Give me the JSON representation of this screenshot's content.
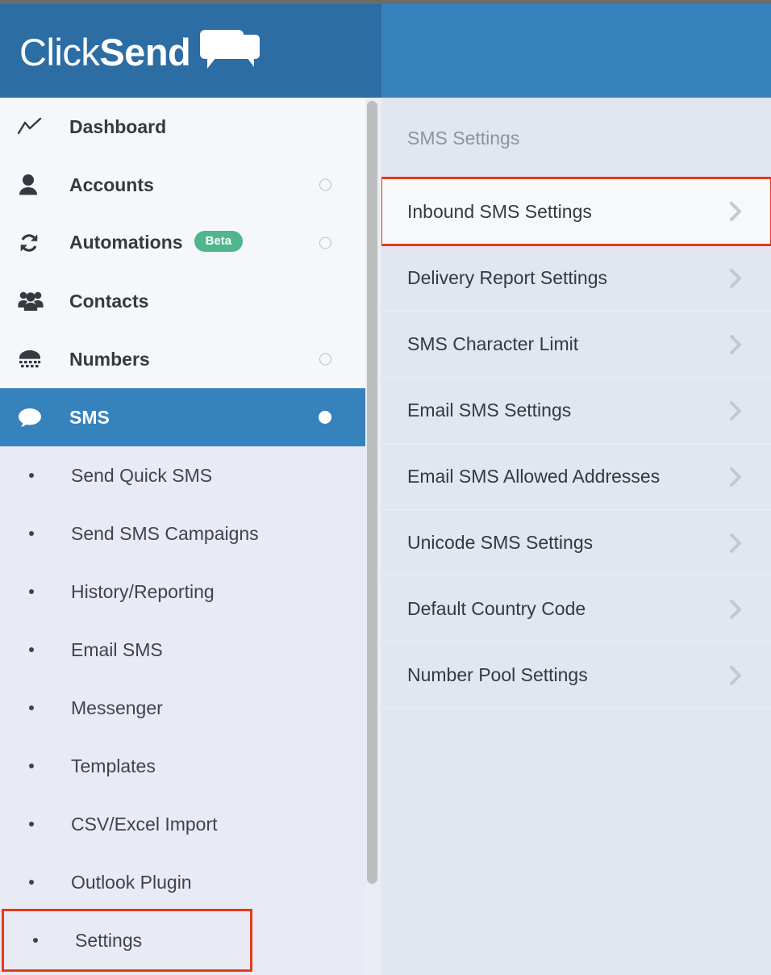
{
  "brand": {
    "name_light": "Click",
    "name_bold": "Send",
    "logo_icon": "chat-bubbles-icon"
  },
  "sidebar": {
    "items": [
      {
        "label": "Dashboard",
        "icon": "line-chart-icon",
        "marker": "none",
        "active": false
      },
      {
        "label": "Accounts",
        "icon": "user-icon",
        "marker": "hollow",
        "active": false
      },
      {
        "label": "Automations",
        "icon": "sync-icon",
        "marker": "hollow",
        "active": false,
        "badge": "Beta"
      },
      {
        "label": "Contacts",
        "icon": "users-group-icon",
        "marker": "none",
        "active": false
      },
      {
        "label": "Numbers",
        "icon": "keypad-icon",
        "marker": "hollow",
        "active": false
      },
      {
        "label": "SMS",
        "icon": "chat-bubble-icon",
        "marker": "filled",
        "active": true
      }
    ],
    "submenu": [
      {
        "label": "Send Quick SMS",
        "boxed": false
      },
      {
        "label": "Send SMS Campaigns",
        "boxed": false
      },
      {
        "label": "History/Reporting",
        "boxed": false
      },
      {
        "label": "Email SMS",
        "boxed": false
      },
      {
        "label": "Messenger",
        "boxed": false
      },
      {
        "label": "Templates",
        "boxed": false
      },
      {
        "label": "CSV/Excel Import",
        "boxed": false
      },
      {
        "label": "Outlook Plugin",
        "boxed": false
      },
      {
        "label": "Settings",
        "boxed": true
      }
    ]
  },
  "panel": {
    "title": "SMS Settings",
    "rows": [
      {
        "label": "Inbound SMS Settings",
        "chevron": "chevron-right-icon",
        "highlighted": true,
        "boxed": true
      },
      {
        "label": "Delivery Report Settings",
        "chevron": "chevron-right-icon",
        "highlighted": false,
        "boxed": false
      },
      {
        "label": "SMS Character Limit",
        "chevron": "chevron-right-icon",
        "highlighted": false,
        "boxed": false
      },
      {
        "label": "Email SMS Settings",
        "chevron": "chevron-right-icon",
        "highlighted": false,
        "boxed": false
      },
      {
        "label": "Email SMS Allowed Addresses",
        "chevron": "chevron-right-icon",
        "highlighted": false,
        "boxed": false
      },
      {
        "label": "Unicode SMS Settings",
        "chevron": "chevron-right-icon",
        "highlighted": false,
        "boxed": false
      },
      {
        "label": "Default Country Code",
        "chevron": "chevron-right-icon",
        "highlighted": false,
        "boxed": false
      },
      {
        "label": "Number Pool Settings",
        "chevron": "chevron-right-icon",
        "highlighted": false,
        "boxed": false
      }
    ]
  },
  "colors": {
    "header_left_blue": "#2c6da4",
    "header_right_blue": "#3682bd",
    "active_blue": "#3682bd",
    "sidebar_bg": "#f5f7fb",
    "submenu_bg": "#e8ebf4",
    "panel_bg": "#e1e6ef",
    "highlight_red": "#e8391a",
    "beta_green": "#4fb68d",
    "text_dark": "#343a40",
    "text_muted": "#8e949e"
  }
}
